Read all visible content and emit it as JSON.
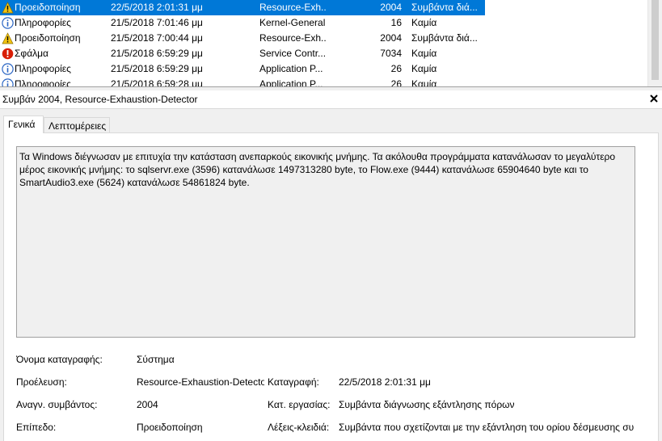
{
  "events": [
    {
      "level": "Προειδοποίηση",
      "date": "22/5/2018 2:01:31 μμ",
      "source": "Resource-Exh...",
      "id": "2004",
      "task": "Συμβάντα διά...",
      "icon": "warning-icon",
      "selected": true
    },
    {
      "level": "Πληροφορίες",
      "date": "21/5/2018 7:01:46 μμ",
      "source": "Kernel-General",
      "id": "16",
      "task": "Καμία",
      "icon": "info-icon",
      "selected": false
    },
    {
      "level": "Προειδοποίηση",
      "date": "21/5/2018 7:00:44 μμ",
      "source": "Resource-Exh...",
      "id": "2004",
      "task": "Συμβάντα διά...",
      "icon": "warning-icon",
      "selected": false
    },
    {
      "level": "Σφάλμα",
      "date": "21/5/2018 6:59:29 μμ",
      "source": "Service Contr...",
      "id": "7034",
      "task": "Καμία",
      "icon": "error-icon",
      "selected": false
    },
    {
      "level": "Πληροφορίες",
      "date": "21/5/2018 6:59:29 μμ",
      "source": "Application P...",
      "id": "26",
      "task": "Καμία",
      "icon": "info-icon",
      "selected": false
    },
    {
      "level": "Πληροφορίες",
      "date": "21/5/2018 6:59:28 μμ",
      "source": "Application P...",
      "id": "26",
      "task": "Καμία",
      "icon": "info-icon",
      "selected": false
    }
  ],
  "detail": {
    "title": "Συμβάν 2004, Resource-Exhaustion-Detector",
    "tabs": {
      "general": "Γενικά",
      "details": "Λεπτομέρειες"
    },
    "message": "Τα Windows διέγνωσαν με επιτυχία την κατάσταση ανεπαρκούς εικονικής μνήμης. Τα ακόλουθα προγράμματα κατανάλωσαν το μεγαλύτερο μέρος εικονικής μνήμης: το sqlservr.exe (3596) κατανάλωσε 1497313280 byte, το Flow.exe (9444) κατανάλωσε 65904640 byte και το SmartAudio3.exe (5624) κατανάλωσε 54861824 byte.",
    "fields": {
      "log_name_label": "Όνομα καταγραφής:",
      "log_name": "Σύστημα",
      "source_label": "Προέλευση:",
      "source": "Resource-Exhaustion-Detecto",
      "logged_label": "Καταγραφή:",
      "logged": "22/5/2018 2:01:31 μμ",
      "event_id_label": "Αναγν. συμβάντος:",
      "event_id": "2004",
      "task_label": "Κατ. εργασίας:",
      "task": "Συμβάντα διάγνωσης εξάντλησης πόρων",
      "level_label": "Επίπεδο:",
      "level": "Προειδοποίηση",
      "keywords_label": "Λέξεις-κλειδιά:",
      "keywords": "Συμβάντα που σχετίζονται με την εξάντληση του ορίου δέσμευσης συ"
    }
  },
  "colors": {
    "selection": "#0078d7",
    "warning": "#f2c311",
    "error": "#d81e06",
    "info": "#2b66c4"
  }
}
